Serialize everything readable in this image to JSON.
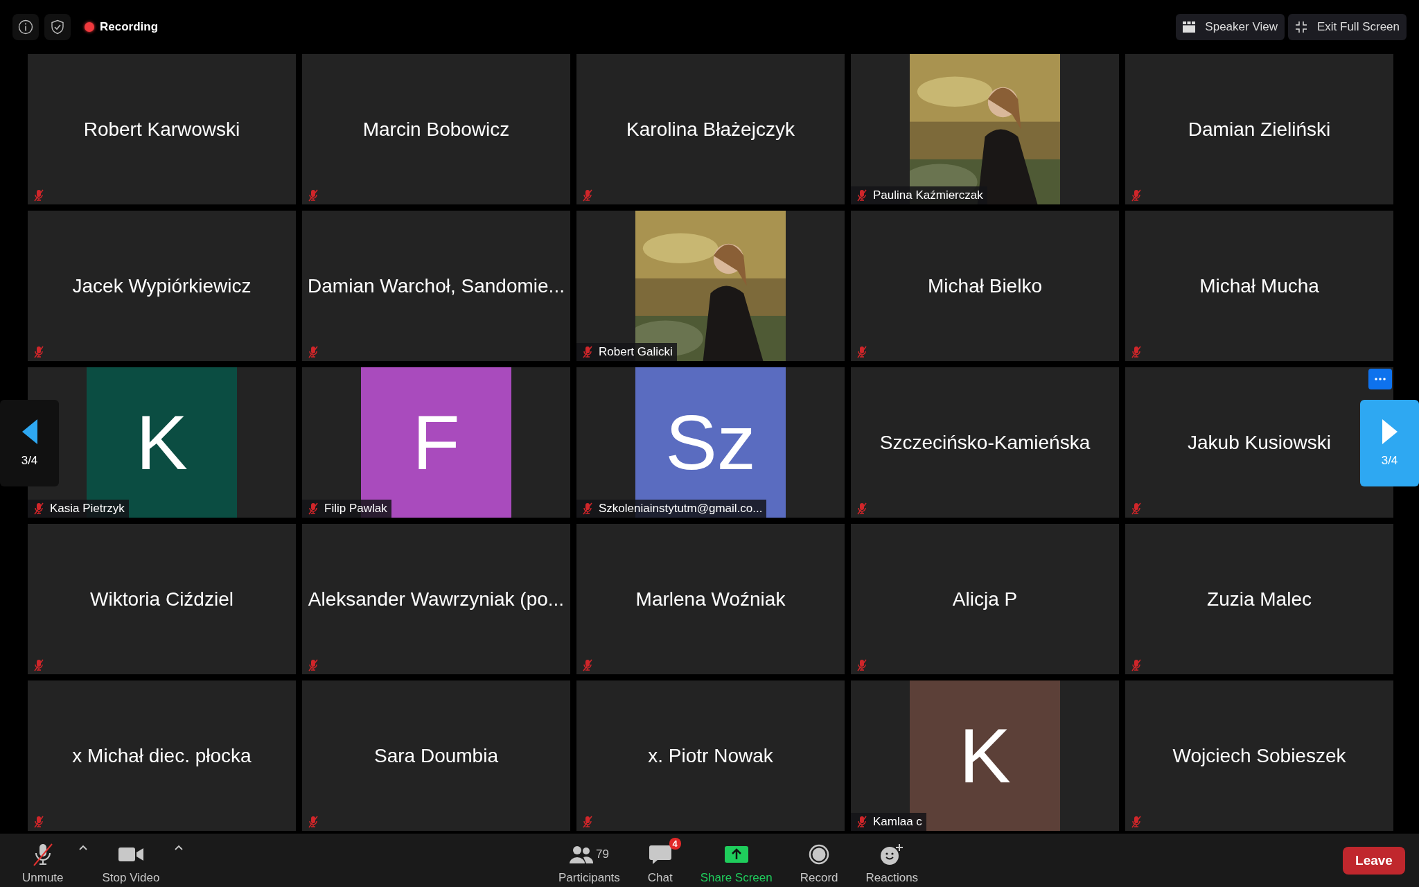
{
  "top_bar": {
    "recording": "Recording",
    "buttons": [
      {
        "kind": "grid",
        "label": "Speaker View"
      },
      {
        "kind": "shrink",
        "label": "Exit Full Screen"
      }
    ]
  },
  "tiles": [
    {
      "kind": "name",
      "name": "Robert Karwowski",
      "muted": true
    },
    {
      "kind": "name",
      "name": "Marcin Bobowicz",
      "muted": true
    },
    {
      "kind": "name",
      "name": "Karolina Błażejczyk",
      "muted": true
    },
    {
      "name": "Paulina Kaźmierczak",
      "muted": true
    },
    {
      "kind": "name",
      "name": "Damian Zieliński",
      "muted": true
    },
    {
      "kind": "name",
      "name": "Jacek Wypiórkiewicz",
      "muted": true
    },
    {
      "kind": "name",
      "name": "Damian Warchoł, Sandomie...",
      "muted": true
    },
    {
      "name": "Robert Galicki",
      "muted": true
    },
    {
      "kind": "name",
      "name": "Michał Bielko",
      "muted": true
    },
    {
      "kind": "name",
      "name": "Michał Mucha",
      "muted": true
    },
    {
      "kind": "avatar",
      "initials": "K",
      "color": "#0b4d42",
      "name": "Kasia Pietrzyk",
      "muted": true
    },
    {
      "kind": "avatar",
      "initials": "F",
      "color": "#a94bbd",
      "name": "Filip Pawlak",
      "muted": true
    },
    {
      "kind": "avatar",
      "initials": "Sz",
      "color": "#5a6cc0",
      "name": "Szkoleniainstytutm@gmail.co...",
      "muted": true
    },
    {
      "kind": "name",
      "name": "Szczecińsko-Kamieńska",
      "muted": true
    },
    {
      "kind": "name",
      "name": "Jakub Kusiowski",
      "muted": true,
      "menu": true
    },
    {
      "kind": "name",
      "name": "Wiktoria Ciździel",
      "muted": true
    },
    {
      "kind": "name",
      "name": "Aleksander Wawrzyniak (po...",
      "muted": true
    },
    {
      "kind": "name",
      "name": "Marlena Woźniak",
      "muted": true
    },
    {
      "kind": "name",
      "name": "Alicja P",
      "muted": true
    },
    {
      "kind": "name",
      "name": "Zuzia Malec",
      "muted": true
    },
    {
      "kind": "name",
      "name": "x Michał diec. płocka",
      "muted": true
    },
    {
      "kind": "name",
      "name": "Sara Doumbia",
      "muted": true
    },
    {
      "kind": "name",
      "name": "x. Piotr Nowak",
      "muted": true
    },
    {
      "kind": "avatar",
      "initials": "K",
      "color": "#5c4038",
      "name": "Kamlaa c",
      "muted": true
    },
    {
      "kind": "name",
      "name": "Wojciech Sobieszek",
      "muted": true
    }
  ],
  "pager": {
    "previous": "3/4",
    "next": "3/4"
  },
  "toolbar": {
    "left": [
      {
        "kind": "mic",
        "label": "Unmute"
      },
      {
        "kind": "video",
        "label": "Stop Video"
      }
    ],
    "center": [
      {
        "kind": "participants",
        "label": "Participants",
        "count": "79"
      },
      {
        "kind": "chat",
        "label": "Chat",
        "badge": "4"
      },
      {
        "kind": "share",
        "label": "Share Screen"
      },
      {
        "kind": "record",
        "label": "Record"
      },
      {
        "kind": "reactions",
        "label": "Reactions"
      }
    ],
    "leave": "Leave"
  }
}
